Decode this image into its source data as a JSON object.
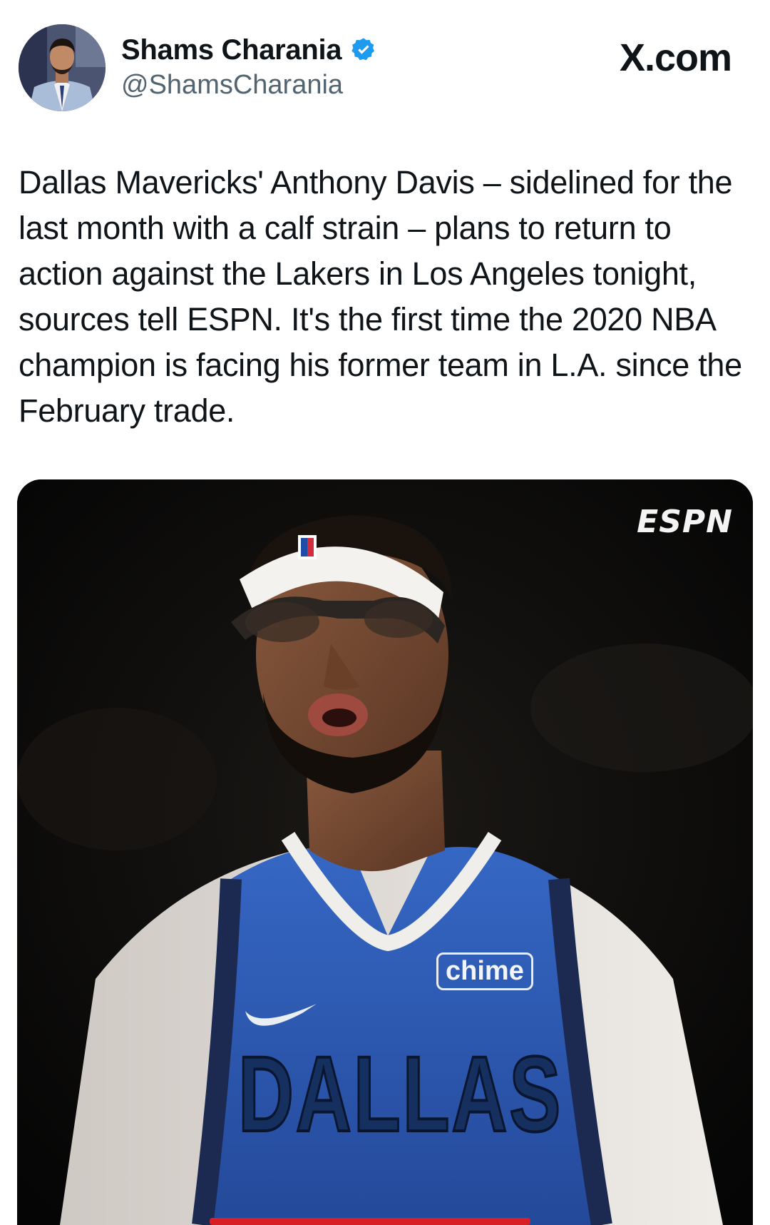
{
  "author": {
    "display_name": "Shams Charania",
    "handle": "@ShamsCharania",
    "verified_icon": "verified-badge-icon"
  },
  "site_label": "X.com",
  "tweet": {
    "text": "Dallas Mavericks' Anthony Davis – sidelined for the last month with a calf strain – plans to return to action against the Lakers in Los Angeles tonight, sources tell ESPN. It's the first time the 2020 NBA champion is facing his former team in L.A. since the February trade."
  },
  "media": {
    "network_logo": "ESPN",
    "jersey_sponsor": "chime",
    "jersey_text": "DALLAS"
  },
  "colors": {
    "verified_blue": "#1d9bf0",
    "jersey_blue": "#2f5fb8",
    "text_primary": "#0f1419",
    "text_secondary": "#536471"
  }
}
